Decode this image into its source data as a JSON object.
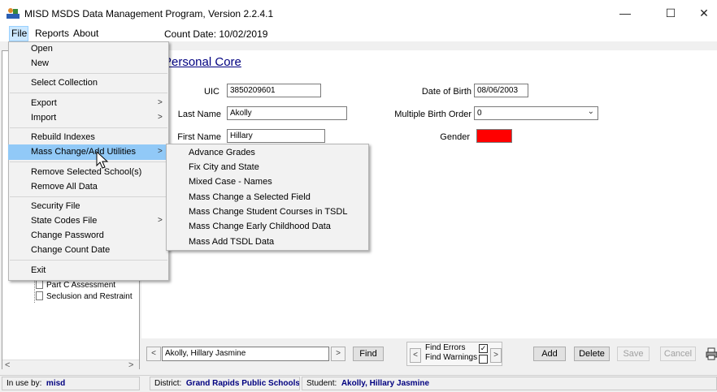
{
  "window": {
    "title": "MISD MSDS Data Management Program,  Version 2.2.4.1",
    "minimize": "—",
    "maximize": "☐",
    "close": "✕"
  },
  "menubar": {
    "file": "File",
    "reports": "Reports",
    "about": "About",
    "count_date": "Count Date: 10/02/2019"
  },
  "file_menu": {
    "items": [
      "Open",
      "New",
      "Select Collection",
      "Export",
      "Import",
      "Rebuild Indexes",
      "Mass Change/Add Utilities",
      "Remove Selected School(s)",
      "Remove All Data",
      "Security File",
      "State Codes File",
      "Change Password",
      "Change Count Date",
      "Exit"
    ],
    "submenu_arrow": ">"
  },
  "mass_change_submenu": {
    "items": [
      "Advance Grades",
      "Fix City and State",
      "Mixed Case - Names",
      "Mass Change a Selected Field",
      "Mass Change Student Courses in TSDL",
      "Mass Change Early Childhood Data",
      "Mass Add TSDL Data"
    ]
  },
  "form": {
    "section_title": "Personal Core",
    "uic_label": "UIC",
    "uic_value": "3850209601",
    "last_name_label": "Last Name",
    "last_name_value": "Akolly",
    "first_name_label": "First Name",
    "first_name_value": "Hillary",
    "dob_label": "Date of Birth",
    "dob_value": "08/06/2003",
    "mbo_label": "Multiple Birth Order",
    "mbo_value": "0",
    "gender_label": "Gender",
    "gender_color": "#ff0000"
  },
  "tree": {
    "items": [
      "Part C Assessment",
      "Seclusion and Restraint"
    ]
  },
  "toolbar": {
    "student_search": "Akolly, Hillary Jasmine",
    "prev": "<",
    "next": ">",
    "find": "Find",
    "find_errors": "Find Errors",
    "find_warnings": "Find Warnings",
    "find_errors_checked": "✓",
    "add": "Add",
    "delete": "Delete",
    "save": "Save",
    "cancel": "Cancel"
  },
  "statusbar": {
    "in_use_label": "In use by:",
    "in_use_value": "misd",
    "district_label": "District:",
    "district_value": "Grand Rapids Public Schools",
    "student_label": "Student:",
    "student_value": "Akolly, Hillary Jasmine"
  },
  "tree_scroll": {
    "left": "<",
    "right": ">"
  }
}
